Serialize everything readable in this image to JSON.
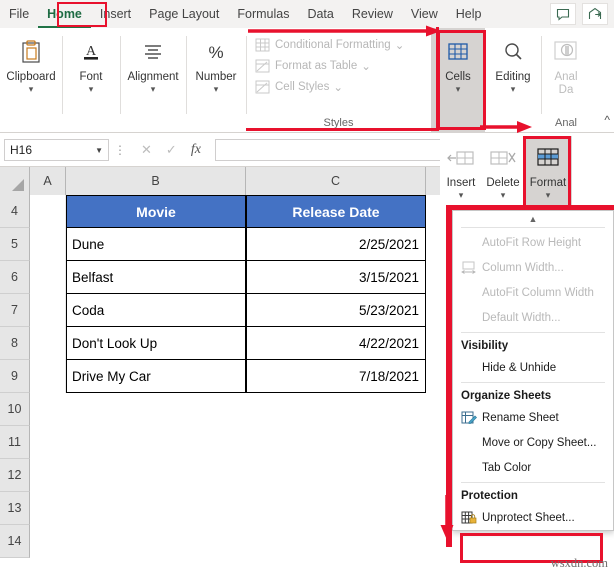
{
  "window": {
    "tabs": [
      {
        "label": "File",
        "active": false
      },
      {
        "label": "Home",
        "active": true
      },
      {
        "label": "Insert",
        "active": false
      },
      {
        "label": "Page Layout",
        "active": false
      },
      {
        "label": "Formulas",
        "active": false
      },
      {
        "label": "Data",
        "active": false
      },
      {
        "label": "Review",
        "active": false
      },
      {
        "label": "View",
        "active": false
      },
      {
        "label": "Help",
        "active": false
      }
    ],
    "comment_icon": "comment-icon",
    "share_icon": "share-icon"
  },
  "ribbon": {
    "groups": [
      {
        "label": "Clipboard",
        "icon": "clipboard-icon"
      },
      {
        "label": "Font",
        "icon": "font-a-icon"
      },
      {
        "label": "Alignment",
        "icon": "alignment-icon"
      },
      {
        "label": "Number",
        "icon": "percent-icon"
      }
    ],
    "styles": {
      "group_label": "Styles",
      "items": [
        {
          "label": "Conditional Formatting",
          "icon": "conditional-formatting-icon",
          "has_caret": true
        },
        {
          "label": "Format as Table",
          "icon": "format-as-table-icon",
          "has_caret": true
        },
        {
          "label": "Cell Styles",
          "icon": "cell-styles-icon",
          "has_caret": true
        }
      ]
    },
    "cells": {
      "label": "Cells",
      "icon": "cells-icon",
      "selected": true
    },
    "editing": {
      "label": "Editing",
      "icon": "magnifier-icon"
    },
    "analyze": {
      "label_line1": "Anal",
      "label_line2": "Da",
      "group_label": "Anal",
      "icon": "analyze-data-icon"
    }
  },
  "cells_dropdown_buttons": [
    {
      "label": "Insert",
      "icon": "insert-cells-icon"
    },
    {
      "label": "Delete",
      "icon": "delete-cells-icon"
    },
    {
      "label": "Format",
      "icon": "format-cells-icon",
      "highlighted": true
    }
  ],
  "formula_bar": {
    "name_box_value": "H16",
    "cancel_icon": "cancel-x-icon",
    "enter_icon": "enter-check-icon",
    "function_icon": "fx-icon",
    "formula_value": ""
  },
  "grid": {
    "column_headers": [
      "A",
      "B",
      "C"
    ],
    "row_headers": [
      "4",
      "5",
      "6",
      "7",
      "8",
      "9",
      "10",
      "11",
      "12",
      "13",
      "14"
    ],
    "table": {
      "headers": [
        "Movie",
        "Release Date"
      ],
      "header_bg": "#4472C4",
      "header_fg": "#FFFFFF",
      "rows": [
        {
          "movie": "Dune",
          "date": "2/25/2021"
        },
        {
          "movie": "Belfast",
          "date": "3/15/2021"
        },
        {
          "movie": "Coda",
          "date": "5/23/2021"
        },
        {
          "movie": "Don't Look Up",
          "date": "4/22/2021"
        },
        {
          "movie": "Drive My Car",
          "date": "7/18/2021"
        }
      ]
    }
  },
  "format_menu": {
    "scroll_up": "scroll-up-arrow",
    "items_cell_size": [
      {
        "label": "AutoFit Row Height",
        "disabled": true,
        "icon": null
      },
      {
        "label": "Column Width...",
        "disabled": true,
        "icon": "column-width-icon"
      },
      {
        "label": "AutoFit Column Width",
        "disabled": true,
        "icon": null
      },
      {
        "label": "Default Width...",
        "disabled": true,
        "icon": null
      }
    ],
    "visibility_header": "Visibility",
    "items_visibility": [
      {
        "label": "Hide & Unhide",
        "disabled": false,
        "icon": null
      }
    ],
    "organize_header": "Organize Sheets",
    "items_organize": [
      {
        "label": "Rename Sheet",
        "disabled": false,
        "icon": "rename-sheet-icon"
      },
      {
        "label": "Move or Copy Sheet...",
        "disabled": false,
        "icon": null
      },
      {
        "label": "Tab Color",
        "disabled": false,
        "icon": null
      }
    ],
    "protection_header": "Protection",
    "items_protection": [
      {
        "label": "Unprotect Sheet...",
        "disabled": false,
        "icon": "unprotect-sheet-icon",
        "highlighted": true
      }
    ]
  },
  "annotations": {
    "highlight_color": "#E8112D",
    "watermark": "wsxdn.com"
  }
}
